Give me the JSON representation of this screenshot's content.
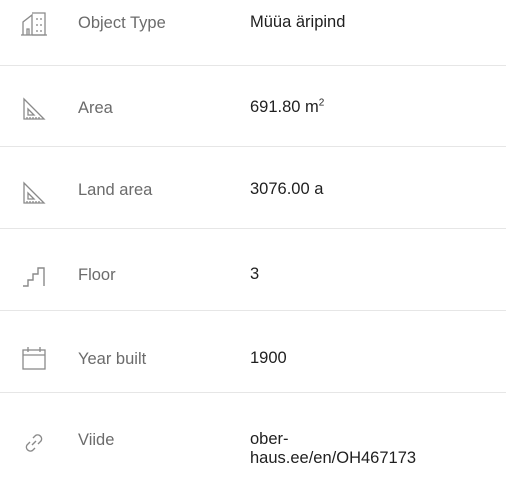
{
  "details": {
    "object_type": {
      "label": "Object Type",
      "value": "Müüa äripind",
      "icon": "building-icon"
    },
    "area": {
      "label": "Area",
      "value": "691.80 m",
      "unit_sup": "2",
      "icon": "set-square-icon"
    },
    "land_area": {
      "label": "Land area",
      "value": "3076.00 a",
      "icon": "set-square-icon"
    },
    "floor": {
      "label": "Floor",
      "value": "3",
      "icon": "stairs-icon"
    },
    "year_built": {
      "label": "Year built",
      "value": "1900",
      "icon": "calendar-icon"
    },
    "reference": {
      "label": "Viide",
      "value_line1": "ober-",
      "value_line2": "haus.ee/en/OH467173",
      "icon": "link-icon"
    }
  },
  "colors": {
    "label": "#6b6b6b",
    "value": "#1f1f1f",
    "icon_stroke": "#8a8a8a",
    "divider": "#e6e6e6"
  }
}
